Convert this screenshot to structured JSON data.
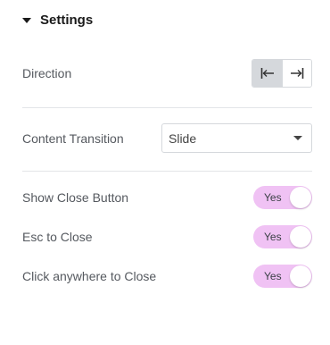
{
  "section": {
    "title": "Settings"
  },
  "direction": {
    "label": "Direction",
    "options": [
      {
        "icon": "align-start-icon",
        "active": true
      },
      {
        "icon": "align-end-icon",
        "active": false
      }
    ]
  },
  "content_transition": {
    "label": "Content Transition",
    "value": "Slide"
  },
  "toggles": [
    {
      "label": "Show Close Button",
      "state": "Yes"
    },
    {
      "label": "Esc to Close",
      "state": "Yes"
    },
    {
      "label": "Click anywhere to Close",
      "state": "Yes"
    }
  ],
  "colors": {
    "toggle_on": "#f0c2f4",
    "active_segment": "#d5d8dc",
    "divider": "#e3e5e8"
  }
}
